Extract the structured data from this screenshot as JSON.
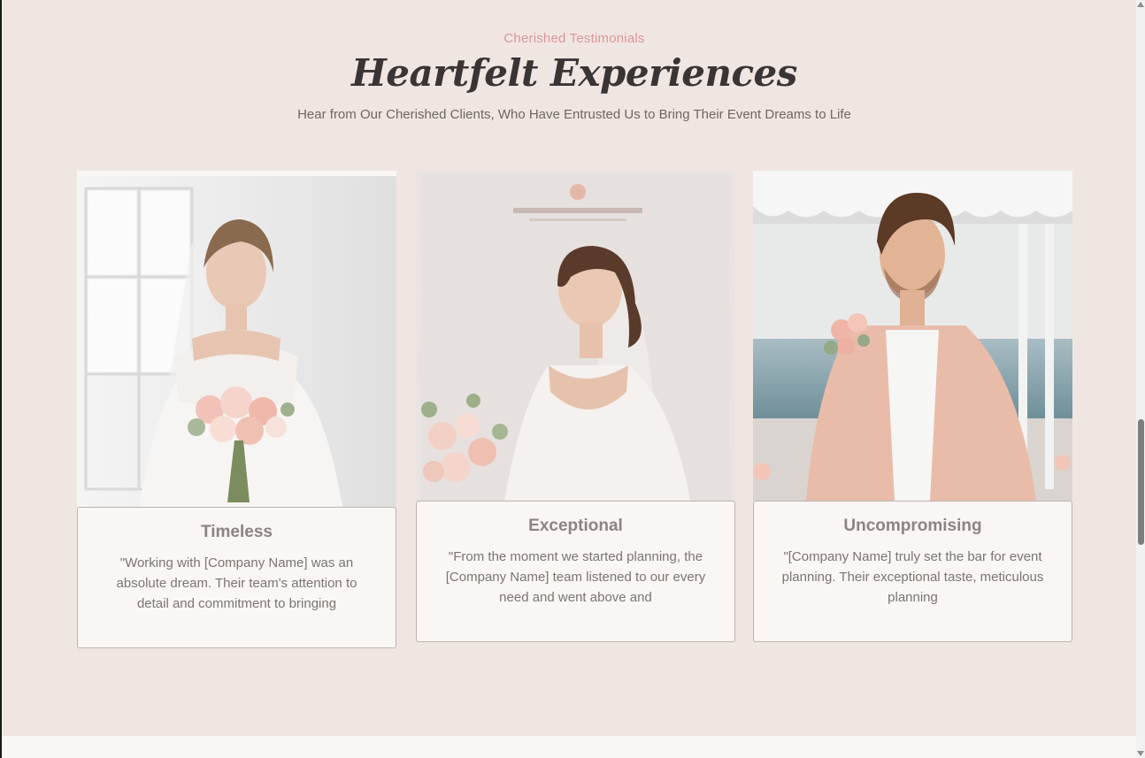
{
  "section": {
    "eyebrow": "Cherished Testimonials",
    "title": "Heartfelt Experiences",
    "subtitle": "Hear from Our Cherished Clients, Who Have Entrusted Us to Bring Their Event Dreams to Life"
  },
  "testimonials": [
    {
      "title": "Timeless",
      "quote": "\"Working with [Company Name] was an absolute dream. Their team's attention to detail and commitment to bringing",
      "image": "bride-with-bouquet-photo"
    },
    {
      "title": "Exceptional",
      "quote": "\"From the moment we started planning, the [Company Name] team listened to our every need and went above and",
      "image": "smiling-bride-photo"
    },
    {
      "title": "Uncompromising",
      "quote": "\"[Company Name] truly set the bar for event planning. Their exceptional taste, meticulous planning",
      "image": "groom-pink-suit-photo"
    }
  ],
  "colors": {
    "background": "#f0e6e1",
    "accent": "#d9969a",
    "heading": "#3a3535",
    "card": "#f9f6f3"
  }
}
